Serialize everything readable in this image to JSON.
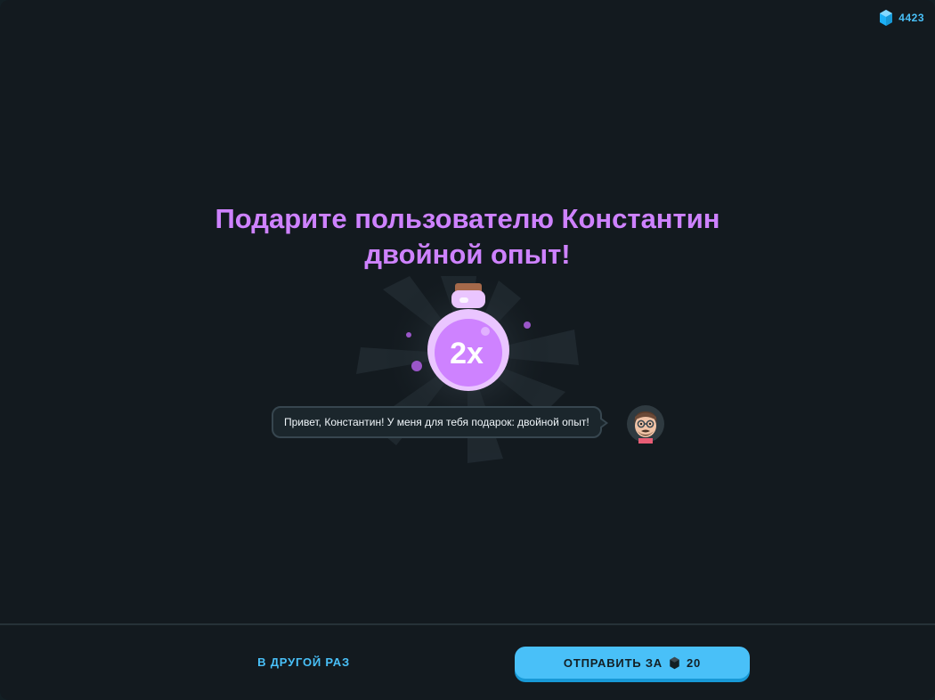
{
  "gems": {
    "count": "4423",
    "icon": "gem-icon",
    "color": "#49c0f8"
  },
  "title": {
    "line1": "Подарите пользователю Константин",
    "line2": "двойной опыт!"
  },
  "gift": {
    "potion_label": "2x",
    "icon": "xp-potion-icon",
    "color": "#ce82ff"
  },
  "message": {
    "text": "Привет, Константин! У меня для тебя подарок: двойной опыт!"
  },
  "footer": {
    "later_label": "В ДРУГОЙ РАЗ",
    "send_label": "ОТПРАВИТЬ ЗА",
    "send_cost": "20",
    "cost_icon": "gem-icon"
  },
  "colors": {
    "background": "#131a1f",
    "accent_purple": "#ce82ff",
    "accent_blue": "#49c0f8"
  }
}
